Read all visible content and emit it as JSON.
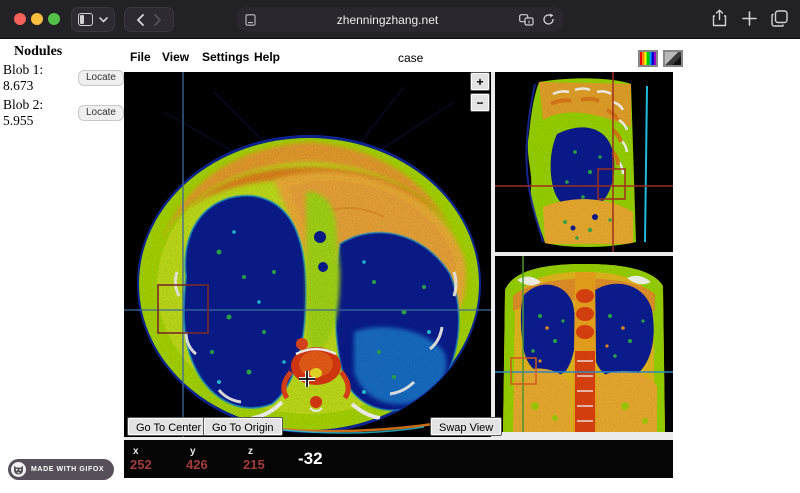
{
  "browser": {
    "url": "zhenningzhang.net"
  },
  "sidebar": {
    "title": "Nodules",
    "nodules": [
      {
        "label": "Blob 1: 8.673",
        "action": "Locate"
      },
      {
        "label": "Blob 2: 5.955",
        "action": "Locate"
      }
    ]
  },
  "menu": {
    "items": [
      "File",
      "View",
      "Settings",
      "Help"
    ],
    "title": "case"
  },
  "viewer": {
    "zoom_in": "+",
    "zoom_out": "−",
    "buttons": {
      "go_center": "Go To Center",
      "go_origin": "Go To Origin",
      "swap": "Swap View"
    },
    "status": {
      "x_label": "x",
      "y_label": "y",
      "z_label": "z",
      "x": "252",
      "y": "426",
      "z": "215",
      "intensity": "-32"
    }
  },
  "badge": {
    "text": "MADE WITH GIFOX"
  },
  "colors": {
    "status_value": "#a33c3c",
    "axial_crosshair": "#3c6a9c",
    "axial_box": "#7c2b26",
    "sagittal_crosshair": "#9e2e22",
    "sagittal_box": "#9e2e22",
    "coronal_h_line": "#2f86c0",
    "coronal_v_line": "#4d9430",
    "coronal_box": "#d2591f"
  }
}
